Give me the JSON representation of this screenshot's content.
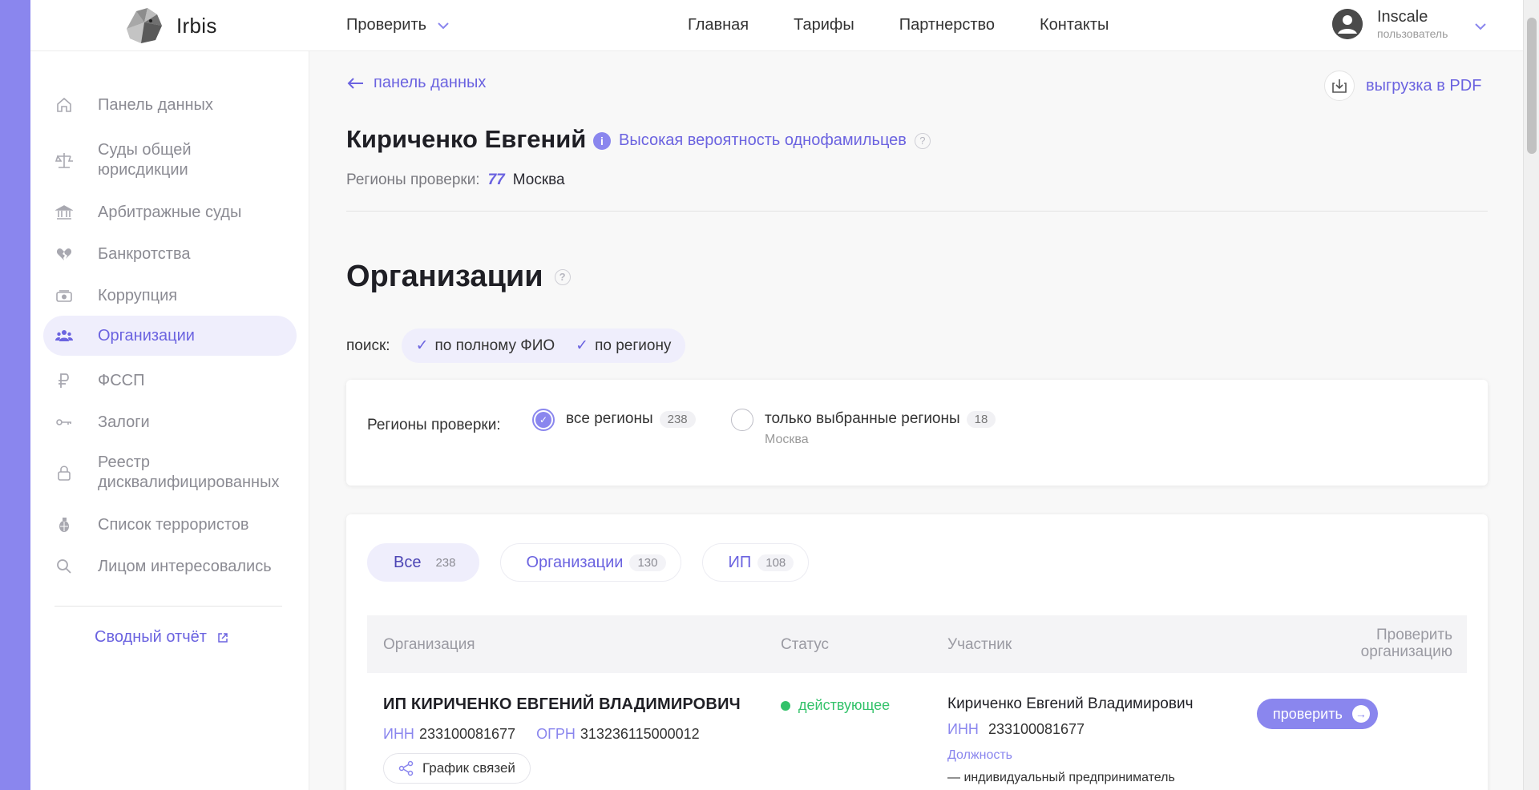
{
  "header": {
    "brand": "Irbis",
    "check_menu": "Проверить",
    "nav": [
      "Главная",
      "Тарифы",
      "Партнерство",
      "Контакты"
    ],
    "user_name": "Inscale",
    "user_role": "пользователь"
  },
  "sidebar": {
    "items": [
      {
        "label": "Панель данных",
        "icon": "home-icon"
      },
      {
        "label": "Суды общей юрисдикции",
        "icon": "scales-icon"
      },
      {
        "label": "Арбитражные суды",
        "icon": "bank-building-icon"
      },
      {
        "label": "Банкротства",
        "icon": "broken-heart-icon"
      },
      {
        "label": "Коррупция",
        "icon": "money-icon"
      },
      {
        "label": "Организации",
        "icon": "group-icon"
      },
      {
        "label": "ФССП",
        "icon": "ruble-icon"
      },
      {
        "label": "Залоги",
        "icon": "car-key-icon"
      },
      {
        "label": "Реестр дисквалифицированных",
        "icon": "lock-icon"
      },
      {
        "label": "Список террористов",
        "icon": "grenade-icon"
      },
      {
        "label": "Лицом интересовались",
        "icon": "search-icon"
      }
    ],
    "active_index": 5,
    "report_link": "Сводный отчёт"
  },
  "main": {
    "back_link": "панель данных",
    "pdf_export": "выгрузка в PDF",
    "person_name": "Кириченко Евгений",
    "probability_note": "Высокая вероятность однофамильцев",
    "regions_label": "Регионы проверки:",
    "region_code": "77",
    "region_city": "Москва",
    "section_title": "Организации",
    "search_label": "поиск:",
    "search_options": [
      "по полному ФИО",
      "по региону"
    ],
    "regions_card": {
      "label": "Регионы проверки:",
      "all_label": "все регионы",
      "all_count": "238",
      "selected_label": "только выбранные регионы",
      "selected_count": "18",
      "selected_sub": "Москва"
    },
    "tabs": [
      {
        "label": "Все",
        "count": "238"
      },
      {
        "label": "Организации",
        "count": "130"
      },
      {
        "label": "ИП",
        "count": "108"
      }
    ],
    "table": {
      "headers": [
        "Организация",
        "Статус",
        "Участник",
        "Проверить организацию"
      ],
      "rows": [
        {
          "org": "ИП КИРИЧЕНКО ЕВГЕНИЙ ВЛАДИМИРОВИЧ",
          "inn_label": "ИНН",
          "inn": "233100081677",
          "ogrn_label": "ОГРН",
          "ogrn": "313236115000012",
          "graph_button": "График связей",
          "status": "действующее",
          "participant": "Кириченко Евгений Владимирович",
          "p_inn_label": "ИНН",
          "p_inn": "233100081677",
          "position_label": "Должность",
          "position": "— индивидуальный предприниматель",
          "check_button": "проверить"
        }
      ]
    }
  },
  "colors": {
    "accent": "#8a86ee",
    "accent_text": "#6b63e0",
    "status_active": "#33c26a"
  }
}
